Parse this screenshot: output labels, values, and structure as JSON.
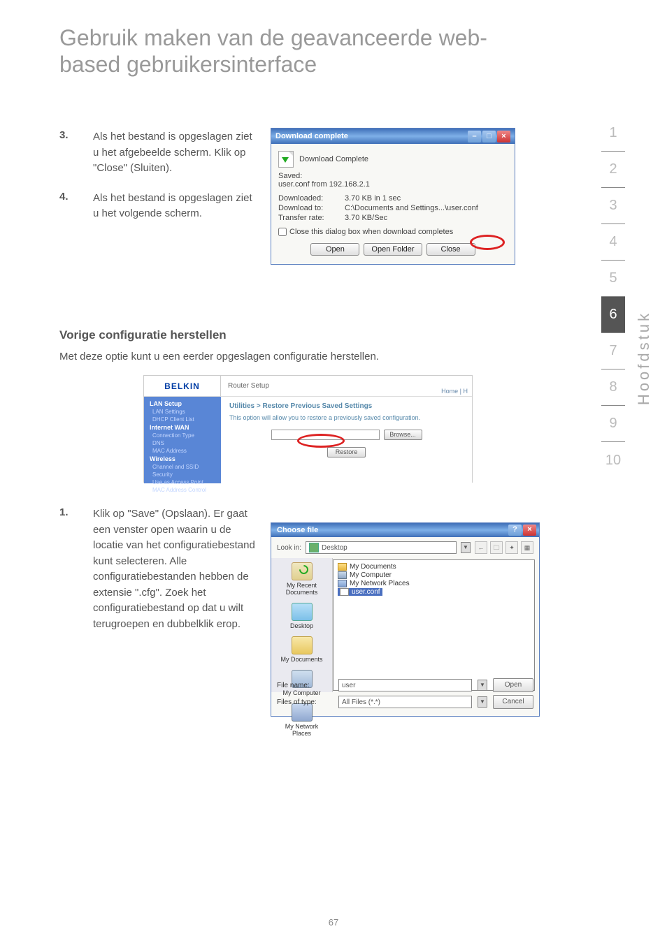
{
  "header": {
    "title_line1": "Gebruik maken van de geavanceerde web-",
    "title_line2": "based gebruikersinterface"
  },
  "sidebar_nav": [
    "1",
    "2",
    "3",
    "4",
    "5",
    "6",
    "7",
    "8",
    "9",
    "10"
  ],
  "sidebar_active_index": 5,
  "vertical_label": "Hoofdstuk",
  "step_block_a": {
    "item3_num": "3.",
    "item3_text": "Als het bestand is opgeslagen ziet u het afgebeelde scherm. Klik op \"Close\" (Sluiten).",
    "item4_num": "4.",
    "item4_text": "Als het bestand is opgeslagen ziet u het volgende scherm."
  },
  "download_dialog": {
    "title": "Download complete",
    "complete_label": "Download Complete",
    "saved_label": "Saved:",
    "saved_value": "user.conf from 192.168.2.1",
    "downloaded_label": "Downloaded:",
    "downloaded_value": "3.70 KB in 1 sec",
    "downloadto_label": "Download to:",
    "downloadto_value": "C:\\Documents and Settings...\\user.conf",
    "rate_label": "Transfer rate:",
    "rate_value": "3.70 KB/Sec",
    "checkbox_label": "Close this dialog box when download completes",
    "open_btn": "Open",
    "openfolder_btn": "Open Folder",
    "close_btn": "Close"
  },
  "subtitle": "Vorige configuratie herstellen",
  "subtitle_desc": "Met deze optie kunt u een eerder opgeslagen configuratie herstellen.",
  "router": {
    "logo": "BELKIN",
    "title": "Router Setup",
    "meta": "Home | H",
    "sidebar": {
      "lan_setup": "LAN Setup",
      "lan_settings": "LAN Settings",
      "dhcp": "DHCP Client List",
      "internet_wan": "Internet WAN",
      "conn_type": "Connection Type",
      "dns": "DNS",
      "mac": "MAC Address",
      "wireless": "Wireless",
      "channel": "Channel and SSID",
      "security": "Security",
      "useap": "Use as Access Point",
      "maccontrol": "MAC Address Control"
    },
    "crumb": "Utilities > Restore Previous Saved Settings",
    "content_desc": "This option will allow you to restore a previously saved configuration.",
    "browse_btn": "Browse...",
    "restore_btn": "Restore"
  },
  "step_block_b": {
    "item1_num": "1.",
    "item1_text": "Klik op \"Save\" (Opslaan). Er gaat een venster open waarin u de locatie van het configuratiebestand kunt selecteren. Alle configuratiebestanden hebben de extensie \".cfg\". Zoek het configuratiebestand op dat u wilt terugroepen en dubbelklik erop."
  },
  "choose_dialog": {
    "title": "Choose file",
    "lookin_label": "Look in:",
    "lookin_value": "Desktop",
    "nav_back": "←",
    "nav_up": "🗀",
    "nav_new": "✦",
    "nav_view": "▦",
    "places": {
      "recent": "My Recent\nDocuments",
      "desktop": "Desktop",
      "docs": "My Documents",
      "computer": "My Computer",
      "network": "My Network\nPlaces"
    },
    "files": {
      "mydocs": "My Documents",
      "mycomputer": "My Computer",
      "mynetplaces": "My Network Places",
      "userconf": "user.conf"
    },
    "filename_label": "File name:",
    "filename_value": "user",
    "filetype_label": "Files of type:",
    "filetype_value": "All Files (*.*)",
    "open_btn": "Open",
    "cancel_btn": "Cancel"
  },
  "page_number": "67"
}
